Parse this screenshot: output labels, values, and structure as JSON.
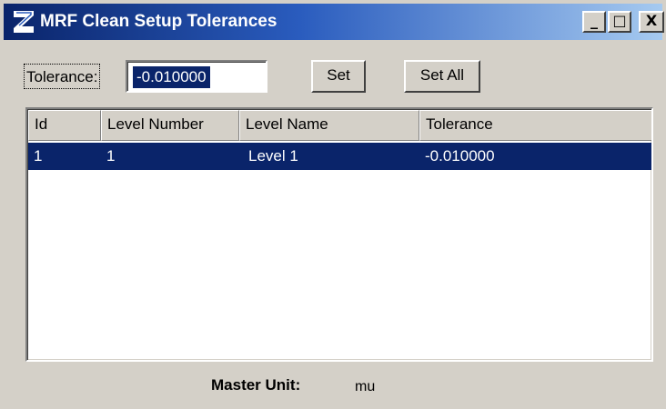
{
  "window": {
    "title": "MRF Clean Setup Tolerances",
    "minimize_glyph": "_",
    "maximize_glyph": "□",
    "close_glyph": "X",
    "icon": "app-logo-icon"
  },
  "tolerance": {
    "label": "Tolerance:",
    "value": "-0.010000"
  },
  "buttons": {
    "set_label": "Set",
    "set_all_label": "Set All"
  },
  "list": {
    "columns": [
      "Id",
      "Level Number",
      "Level Name",
      "Tolerance"
    ],
    "rows": [
      {
        "id": "1",
        "level_number": "1",
        "level_name": "Level 1",
        "tolerance": "-0.010000",
        "selected": true
      }
    ]
  },
  "master_unit": {
    "label": "Master Unit:",
    "value": "mu"
  },
  "colors": {
    "titlebar_start": "#0a246a",
    "titlebar_end": "#a6caf0",
    "selection": "#0a246a",
    "face": "#d4d0c8"
  }
}
